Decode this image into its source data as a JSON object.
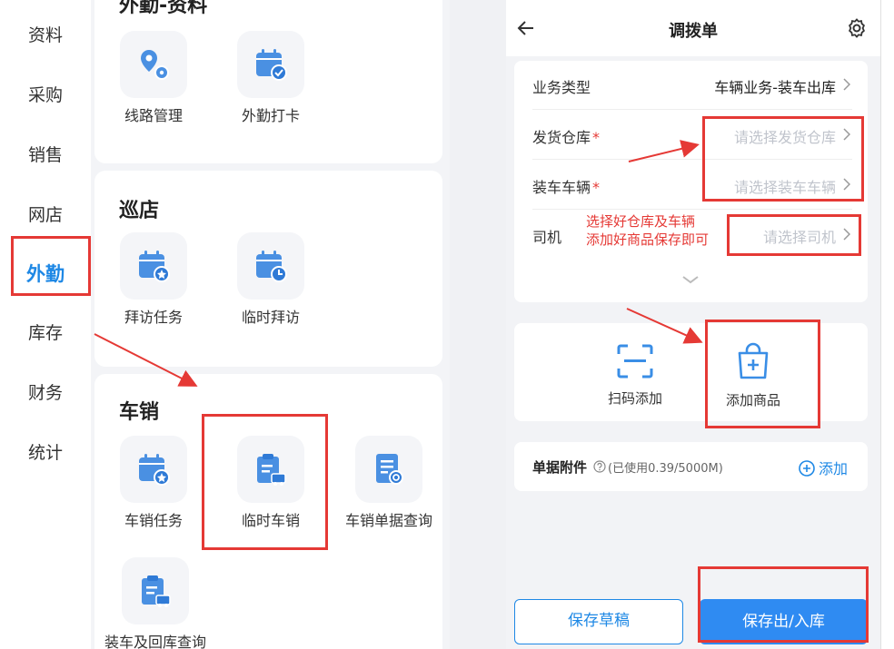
{
  "sidebar": {
    "items": [
      {
        "label": "资料"
      },
      {
        "label": "采购"
      },
      {
        "label": "销售"
      },
      {
        "label": "网店"
      },
      {
        "label": "外勤"
      },
      {
        "label": "库存"
      },
      {
        "label": "财务"
      },
      {
        "label": "统计"
      }
    ],
    "active": "外勤"
  },
  "sections": [
    {
      "title": "外勤-资料",
      "tiles": [
        {
          "label": "线路管理",
          "icon": "route-icon"
        },
        {
          "label": "外勤打卡",
          "icon": "calendar-check-icon"
        }
      ]
    },
    {
      "title": "巡店",
      "tiles": [
        {
          "label": "拜访任务",
          "icon": "calendar-task-icon"
        },
        {
          "label": "临时拜访",
          "icon": "calendar-clock-icon"
        }
      ]
    },
    {
      "title": "车销",
      "tiles": [
        {
          "label": "车销任务",
          "icon": "calendar-task-icon"
        },
        {
          "label": "临时车销",
          "icon": "clipboard-truck-icon"
        },
        {
          "label": "车销单据查询",
          "icon": "document-search-icon"
        },
        {
          "label": "装车及回库查询",
          "icon": "clipboard-truck-icon"
        }
      ]
    }
  ],
  "form": {
    "title": "调拨单",
    "fields": [
      {
        "label": "业务类型",
        "required": false,
        "value": "车辆业务-装车出库",
        "placeholder": ""
      },
      {
        "label": "发货仓库",
        "required": true,
        "value": "",
        "placeholder": "请选择发货仓库"
      },
      {
        "label": "装车车辆",
        "required": true,
        "value": "",
        "placeholder": "请选择装车车辆"
      },
      {
        "label": "司机",
        "required": false,
        "value": "",
        "placeholder": "请选择司机"
      }
    ],
    "required_mark": "*",
    "add_buttons": [
      {
        "label": "扫码添加",
        "icon": "scan-icon"
      },
      {
        "label": "添加商品",
        "icon": "shopping-bag-plus-icon"
      }
    ],
    "attachments": {
      "title": "单据附件",
      "usage": "(已使用0.39/5000M)",
      "add_label": "添加"
    },
    "save_draft_label": "保存草稿",
    "save_submit_label": "保存出/入库"
  },
  "annotation": {
    "note_line1": "选择好仓库及车辆",
    "note_line2": "添加好商品保存即可"
  },
  "colors": {
    "accent": "#1e88e5",
    "primary_button": "#2f8bf2",
    "annotation": "#e53935",
    "icon_blue": "#4a90e2"
  }
}
